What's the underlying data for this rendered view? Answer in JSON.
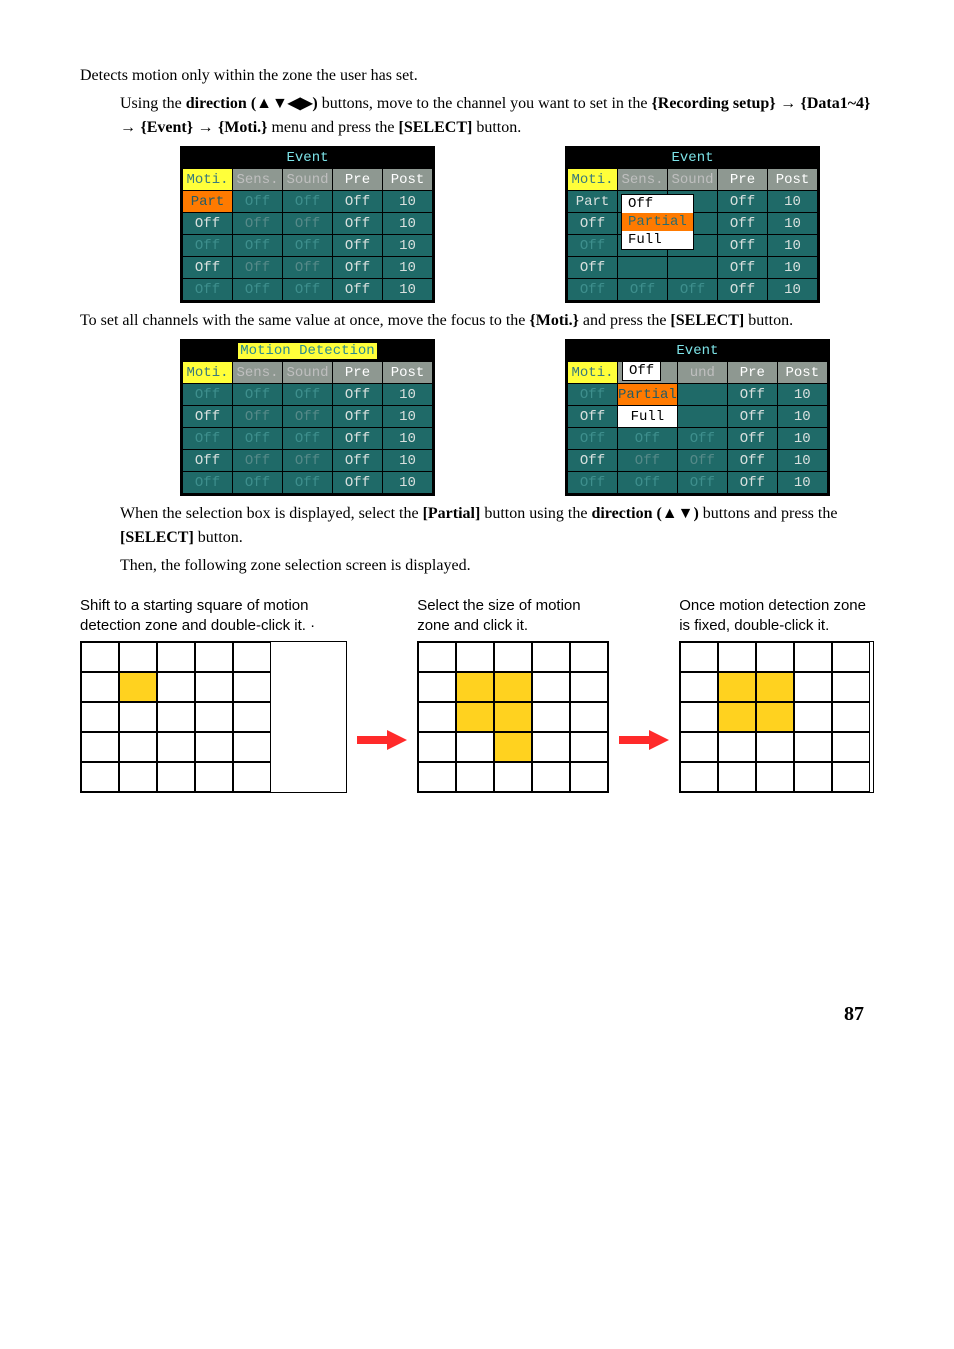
{
  "text": {
    "line1": "Detects motion only within the zone the user has set.",
    "line2a": "Using the ",
    "line2b": "direction (▲▼◀▶)",
    "line2c": " buttons, move to the channel you want to set in the ",
    "line2d": "{Recording setup}",
    "arrow": " → ",
    "line2e": "{Data1~4}",
    "line2f": "{Event}",
    "line2g": "{Moti.}",
    "line2h": " menu and press the ",
    "line2i": "[SELECT]",
    "line2j": " button.",
    "line3a": "To set all channels with the same value at once, move the focus to the ",
    "line3b": "{Moti.}",
    "line3c": " and press the ",
    "line3d": "[SELECT]",
    "line3e": " button.",
    "line4a": "When the selection box is displayed, select the ",
    "line4b": "[Partial]",
    "line4c": " button using the ",
    "line4d": "direction (▲▼)",
    "line4e": " buttons and press the ",
    "line4f": "[SELECT]",
    "line4g": " button.",
    "line5": "Then, the following zone selection screen is displayed.",
    "cap1": "Shift to a starting square of motion detection zone and double-click it. ·",
    "cap2": "Select the size of motion zone and click it.",
    "cap3": "Once motion detection zone is fixed, double-click it."
  },
  "labels": {
    "event": "Event",
    "motion": "Motion Detection",
    "moti": "Moti.",
    "sens": "Sens.",
    "sound": "Sound",
    "pre": "Pre",
    "post": "Post",
    "und": "und"
  },
  "vals": {
    "off": "Off",
    "part": "Part",
    "partial": "Partial",
    "full": "Full",
    "off_n": "Off",
    "ten": "10"
  },
  "page": "87"
}
